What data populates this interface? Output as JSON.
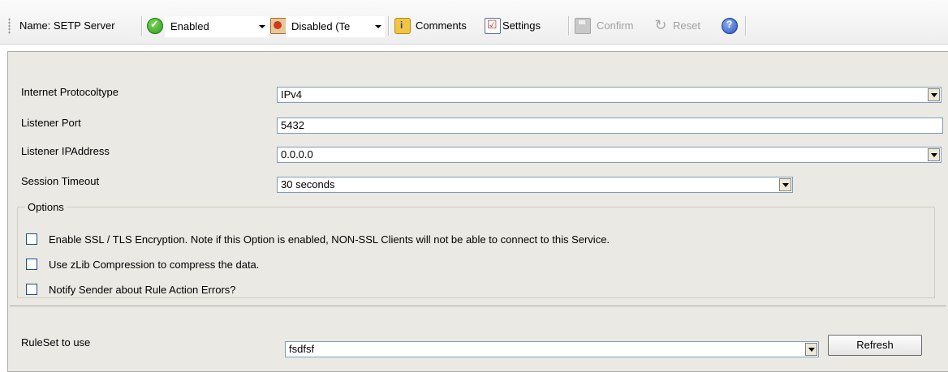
{
  "toolbar": {
    "name_label": "Name: SETP Server",
    "status_select": {
      "value": "Enabled",
      "icon": "check-circle-icon"
    },
    "mode_select": {
      "value": "Disabled (Te",
      "icon": "disabled-icon"
    },
    "comments_label": "Comments",
    "settings_label": "Settings",
    "confirm_label": "Confirm",
    "reset_label": "Reset"
  },
  "form": {
    "protocol": {
      "label": "Internet Protocoltype",
      "value": "IPv4"
    },
    "port": {
      "label": "Listener Port",
      "value": "5432"
    },
    "address": {
      "label": "Listener IPAddress",
      "value": "0.0.0.0"
    },
    "timeout": {
      "label": "Session Timeout",
      "value": "30 seconds"
    }
  },
  "options": {
    "legend": "Options",
    "items": [
      {
        "label": "Enable SSL / TLS Encryption. Note if this Option is enabled, NON-SSL Clients will not be able to connect to this Service.",
        "checked": false
      },
      {
        "label": "Use zLib Compression to compress the data.",
        "checked": false
      },
      {
        "label": "Notify Sender about Rule Action Errors?",
        "checked": false
      }
    ]
  },
  "ruleset": {
    "label": "RuleSet to use",
    "value": "fsdfsf",
    "refresh_label": "Refresh"
  },
  "colors": {
    "panel_bg": "#ebe9e4",
    "field_border": "#7f9db9"
  }
}
